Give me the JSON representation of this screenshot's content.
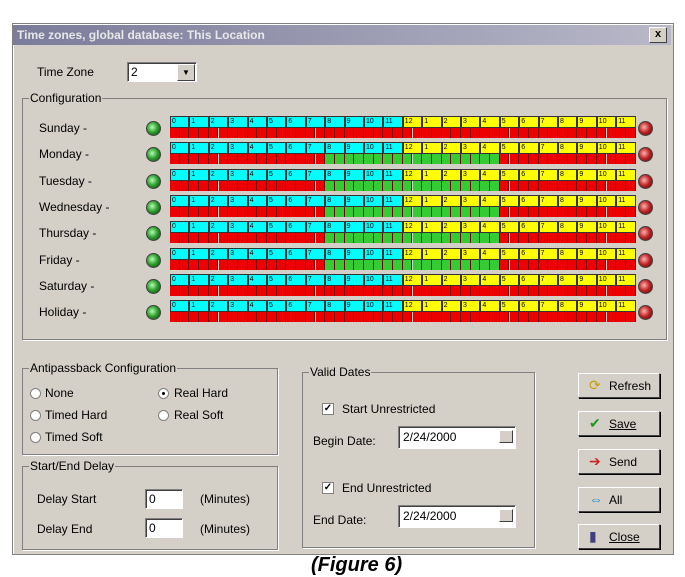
{
  "window": {
    "title": "Time zones, global database: This Location",
    "close_label": "x"
  },
  "timezone": {
    "label": "Time Zone",
    "value": "2"
  },
  "configuration": {
    "label": "Configuration",
    "hour_labels": [
      "0",
      "1",
      "2",
      "3",
      "4",
      "5",
      "6",
      "7",
      "8",
      "9",
      "10",
      "11",
      "12",
      "1",
      "2",
      "3",
      "4",
      "5",
      "6",
      "7",
      "8",
      "9",
      "10",
      "11"
    ],
    "hour_colors": [
      "cyan",
      "cyan",
      "cyan",
      "cyan",
      "cyan",
      "cyan",
      "cyan",
      "cyan",
      "cyan",
      "cyan",
      "cyan",
      "cyan",
      "yellow",
      "yellow",
      "yellow",
      "yellow",
      "yellow",
      "yellow",
      "yellow",
      "yellow",
      "yellow",
      "yellow",
      "yellow",
      "yellow"
    ],
    "colors": {
      "cyan": "#00ffff",
      "yellow": "#ffff00",
      "green": "#33cc33",
      "red": "#ee0000"
    },
    "days": [
      {
        "label": "Sunday -",
        "active_hours": []
      },
      {
        "label": "Monday -",
        "active_hours": [
          8,
          9,
          10,
          11,
          12,
          13,
          14,
          15,
          16
        ]
      },
      {
        "label": "Tuesday -",
        "active_hours": [
          8,
          9,
          10,
          11,
          12,
          13,
          14,
          15,
          16
        ]
      },
      {
        "label": "Wednesday -",
        "active_hours": [
          8,
          9,
          10,
          11,
          12,
          13,
          14,
          15,
          16
        ]
      },
      {
        "label": "Thursday -",
        "active_hours": [
          8,
          9,
          10,
          11,
          12,
          13,
          14,
          15,
          16
        ]
      },
      {
        "label": "Friday -",
        "active_hours": [
          8,
          9,
          10,
          11,
          12,
          13,
          14,
          15,
          16
        ]
      },
      {
        "label": "Saturday -",
        "active_hours": []
      },
      {
        "label": "Holiday -",
        "active_hours": []
      }
    ]
  },
  "antipassback": {
    "label": "Antipassback Configuration",
    "options": [
      {
        "label": "None",
        "selected": false
      },
      {
        "label": "Real Hard",
        "selected": true
      },
      {
        "label": "Timed Hard",
        "selected": false
      },
      {
        "label": "Real Soft",
        "selected": false
      },
      {
        "label": "Timed Soft",
        "selected": false
      }
    ]
  },
  "delay": {
    "label": "Start/End Delay",
    "start_label": "Delay Start",
    "start_value": "0",
    "end_label": "Delay End",
    "end_value": "0",
    "unit": "(Minutes)"
  },
  "valid_dates": {
    "label": "Valid Dates",
    "start_unrestricted": "Start Unrestricted",
    "begin_label": "Begin Date:",
    "begin_value": "2/24/2000",
    "end_unrestricted": "End Unrestricted",
    "end_label": "End Date:",
    "end_value": "2/24/2000"
  },
  "buttons": {
    "refresh": "Refresh",
    "save": "Save",
    "send": "Send",
    "all": "All",
    "close": "Close"
  },
  "caption": "(Figure 6)"
}
